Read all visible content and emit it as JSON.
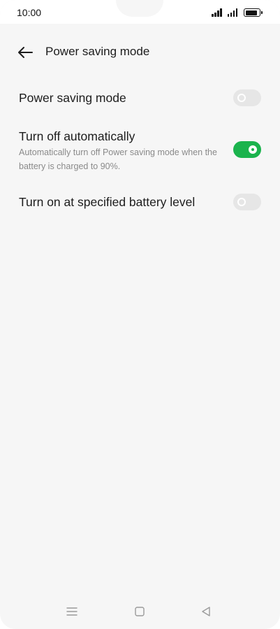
{
  "status_bar": {
    "time": "10:00",
    "icons": [
      "signal-icon",
      "signal-icon",
      "battery-icon"
    ],
    "battery_level": 0.9
  },
  "header": {
    "back_icon": "arrow-left-icon",
    "title": "Power saving mode"
  },
  "settings": [
    {
      "title": "Power saving mode",
      "description": "",
      "toggle": "off"
    },
    {
      "title": "Turn off automatically",
      "description": "Automatically turn off Power saving mode when the battery is charged to 90%.",
      "toggle": "on"
    },
    {
      "title": "Turn on at specified battery level",
      "description": "",
      "toggle": "off"
    }
  ],
  "nav_bar": {
    "icons": [
      "menu-icon",
      "home-icon",
      "back-triangle-icon"
    ]
  },
  "colors": {
    "background": "#f6f6f6",
    "toggle_on": "#1bb34d",
    "toggle_off": "#e6e6e6",
    "description_text": "#8a8a8a"
  }
}
